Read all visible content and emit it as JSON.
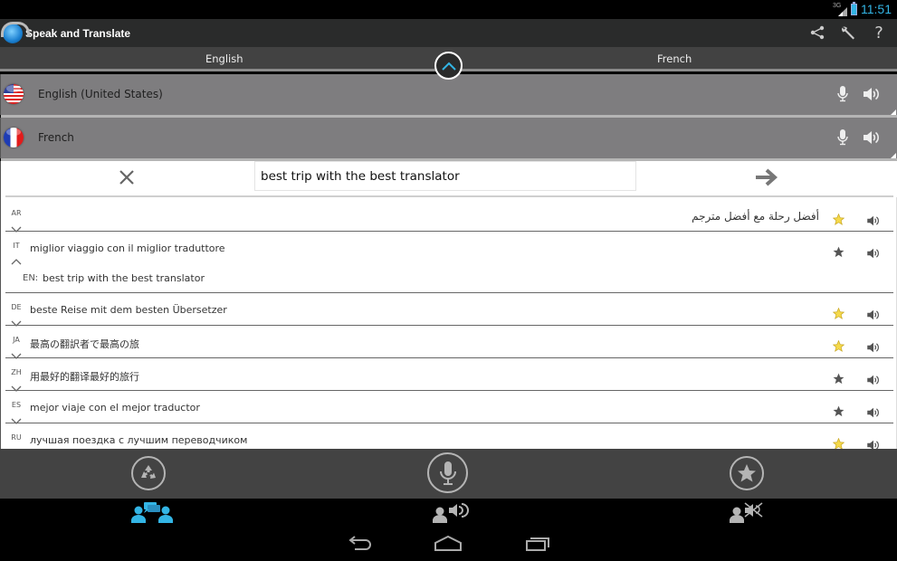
{
  "status_bar": {
    "network": "3G",
    "time": "11:51"
  },
  "app": {
    "title": "Speak and Translate",
    "actions": [
      "share-icon",
      "wrench-settings-icon",
      "help-icon"
    ],
    "help_glyph": "?"
  },
  "language_tabs": {
    "source": "English",
    "target": "French"
  },
  "language_selectors": [
    {
      "name": "English (United States)",
      "flag": "us-flag-icon"
    },
    {
      "name": "French",
      "flag": "france-flag-icon"
    }
  ],
  "input": {
    "value": "best trip with the best translator",
    "placeholder": ""
  },
  "results": [
    {
      "code": "AR",
      "text": "أفضل رحلة مع أفضل مترجم",
      "rtl": true,
      "favorite": false,
      "expanded": false
    },
    {
      "code": "IT",
      "text": "miglior viaggio con il miglior traduttore",
      "rtl": false,
      "favorite": true,
      "expanded": true,
      "back_translation": {
        "code": "EN:",
        "text": "best trip with the best translator"
      }
    },
    {
      "code": "DE",
      "text": "beste Reise mit dem besten Übersetzer",
      "rtl": false,
      "favorite": false,
      "expanded": false
    },
    {
      "code": "JA",
      "text": "最高の翻訳者で最高の旅",
      "rtl": false,
      "favorite": false,
      "expanded": false
    },
    {
      "code": "ZH",
      "text": "用最好的翻译最好的旅行",
      "rtl": false,
      "favorite": true,
      "expanded": false
    },
    {
      "code": "ES",
      "text": "mejor viaje con el mejor traductor",
      "rtl": false,
      "favorite": true,
      "expanded": false
    },
    {
      "code": "RU",
      "text": "лучшая поездка с лучшим переводчиком",
      "rtl": false,
      "favorite": false,
      "expanded": false
    }
  ],
  "bottom_actions": [
    "recycle-clear-icon",
    "microphone-icon",
    "favorites-star-icon"
  ],
  "mode_tabs": [
    {
      "name": "conversation",
      "active": true
    },
    {
      "name": "speak-out",
      "active": false
    },
    {
      "name": "silent",
      "active": false
    }
  ],
  "colors": {
    "accent": "#33b5e5",
    "action_bar": "#2a2b2b",
    "tab_strip": "#424242",
    "selector_bg": "#7e7d7f",
    "star_unfav": "#f5d94a",
    "star_fav": "#555555"
  }
}
